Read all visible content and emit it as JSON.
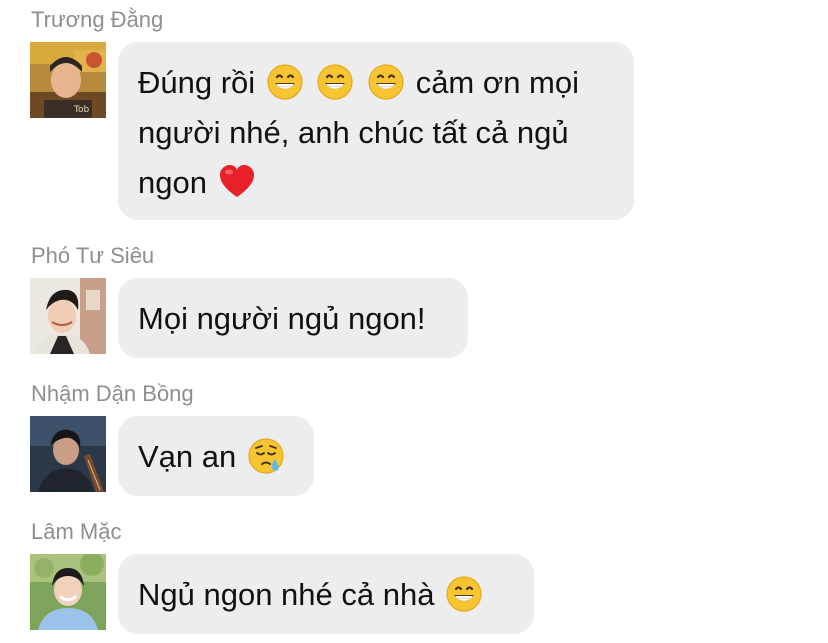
{
  "messages": [
    {
      "sender": "Trương Đằng",
      "avatar_icon": "avatar-truong-dang",
      "text_parts": [
        "Đúng rồi",
        "cảm ơn mọi người nhé, anh chúc tất cả ngủ ngon"
      ],
      "emojis": [
        "grinning-face-icon",
        "grinning-face-icon",
        "grinning-face-icon",
        "red-heart-icon"
      ]
    },
    {
      "sender": "Phó Tư Siêu",
      "avatar_icon": "avatar-pho-tu-sieu",
      "text_parts": [
        "Mọi người ngủ ngon!"
      ],
      "emojis": []
    },
    {
      "sender": "Nhậm Dận Bồng",
      "avatar_icon": "avatar-nham-dan-bong",
      "text_parts": [
        "Vạn an"
      ],
      "emojis": [
        "sleepy-face-icon"
      ]
    },
    {
      "sender": "Lâm Mặc",
      "avatar_icon": "avatar-lam-mac",
      "text_parts": [
        "Ngủ ngon nhé cả nhà"
      ],
      "emojis": [
        "grinning-face-icon"
      ]
    }
  ],
  "colors": {
    "bubble_background": "#ededef",
    "sender_name": "#8e8e93",
    "message_text": "#111111",
    "emoji_yellow": "#f7c531",
    "heart_red": "#e8202a"
  }
}
